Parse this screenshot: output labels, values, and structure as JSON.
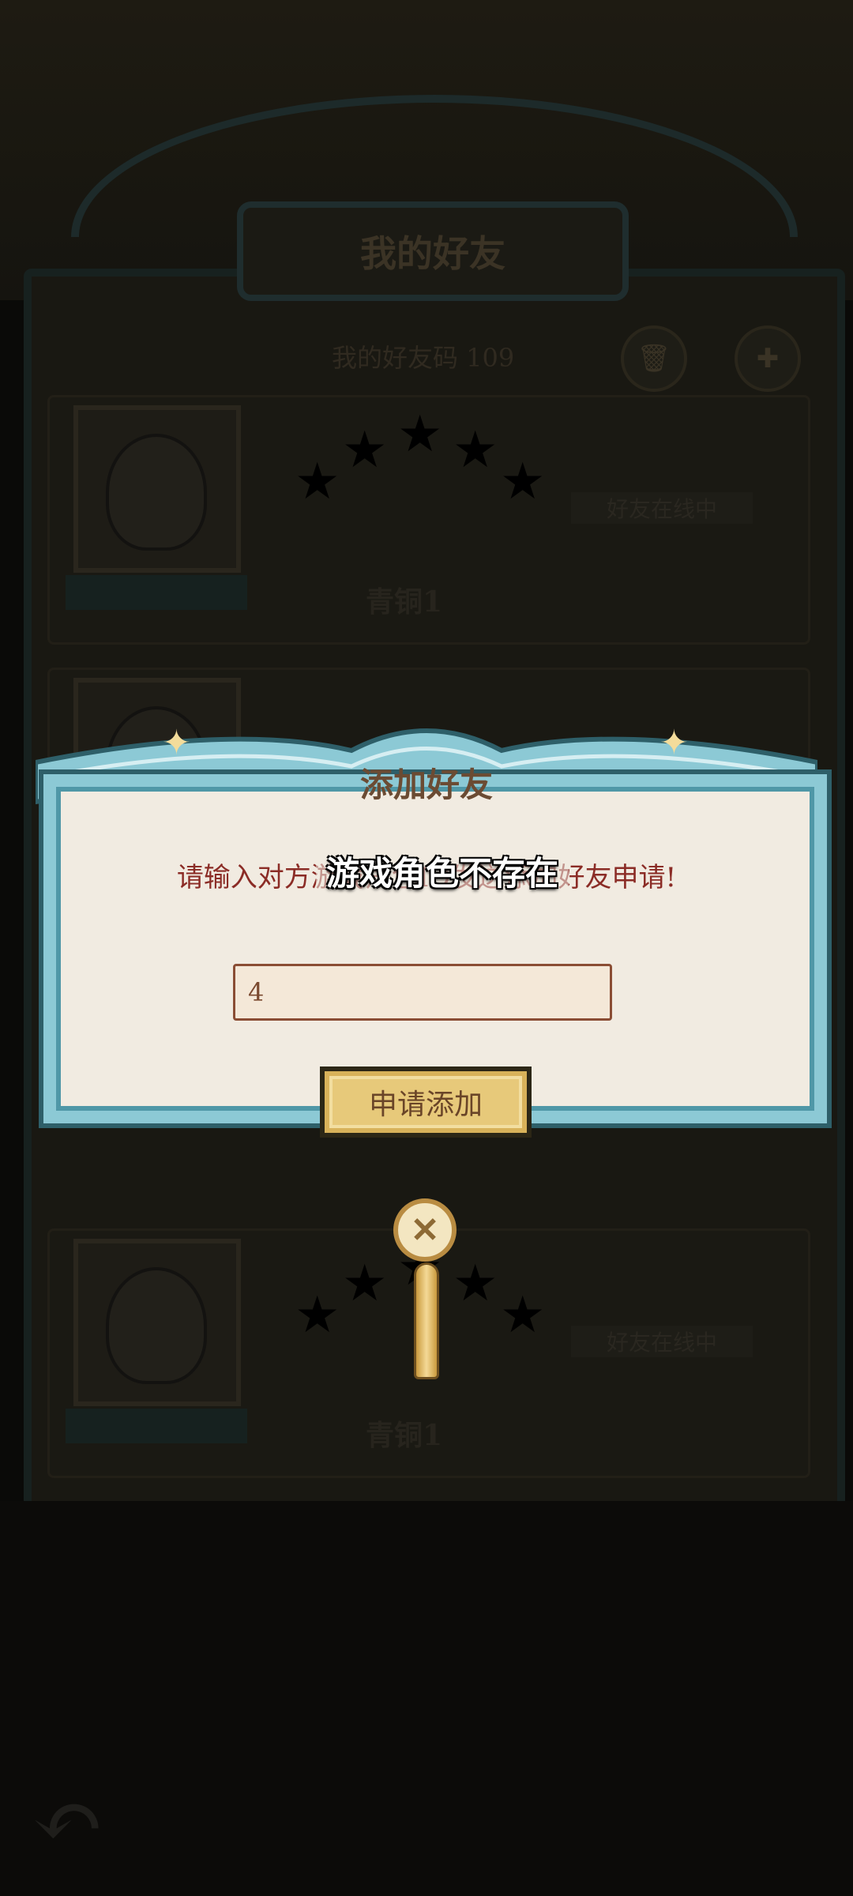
{
  "background": {
    "title": "我的好友",
    "friend_code": "我的好友码 109",
    "friends": [
      {
        "rank": "青铜1",
        "online_status": "好友在线中"
      },
      {
        "rank": "青铜1",
        "online_status": "好友在线中"
      }
    ],
    "icons": [
      "trash-icon",
      "add-friend-icon",
      "back-arrow-icon"
    ]
  },
  "dialog": {
    "title": "添加好友",
    "message": "请输入对方游戏角色ID发送添加好友申请!",
    "toast": "游戏角色不存在",
    "input_value": "4",
    "apply_button": "申请添加",
    "close_icon": "close-icon"
  },
  "colors": {
    "dialog_frame": "#8cc9d5",
    "dialog_bg": "#f1ebe1",
    "message_text": "#8b2c26",
    "button_gold": "#e7c97a"
  }
}
